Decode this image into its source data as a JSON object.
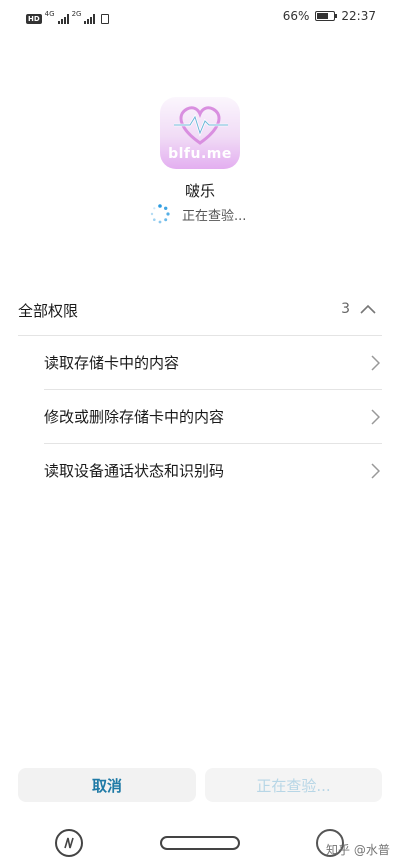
{
  "status_bar": {
    "hd_label": "HD",
    "network_1": "4G",
    "network_2": "2G",
    "battery_percent": "66%",
    "battery_level": 0.66,
    "time": "22:37"
  },
  "app": {
    "icon_text": "blfu.me",
    "name": "啵乐",
    "status": "正在查验..."
  },
  "permissions": {
    "title": "全部权限",
    "count": "3",
    "expanded": true,
    "items": [
      {
        "label": "读取存储卡中的内容"
      },
      {
        "label": "修改或删除存储卡中的内容"
      },
      {
        "label": "读取设备通话状态和识别码"
      }
    ]
  },
  "buttons": {
    "cancel_label": "取消",
    "checking_label": "正在查验..."
  },
  "watermark": "知乎 @水普",
  "colors": {
    "accent": "#1f7aa6",
    "disabled_text": "#b7d6e6",
    "icon_pink": "#e3aef0",
    "spinner_blue": "#2b9be0"
  }
}
